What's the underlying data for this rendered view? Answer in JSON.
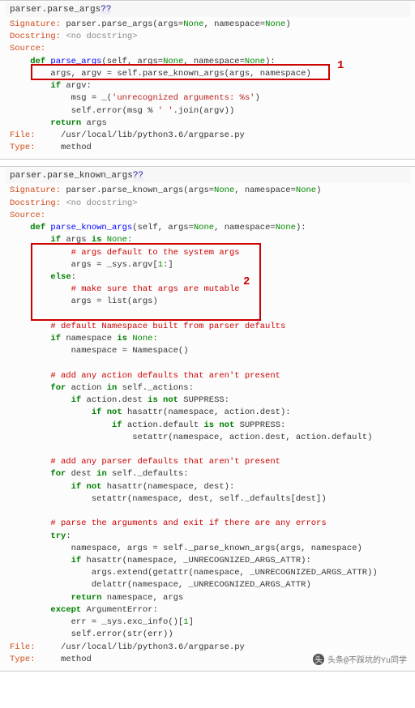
{
  "cell1": {
    "input_prefix": "parser.parse_args",
    "input_suffix": "??",
    "sig_lead": "Signature:",
    "sig_text": " parser.parse_args(args=",
    "sig_none1": "None",
    "sig_mid": ", namespace=",
    "sig_none2": "None",
    "sig_end": ")",
    "doc_lead": "Docstring:",
    "doc_text": " <no docstring>",
    "src_lead": "Source:",
    "def_kw": "def",
    "def_name": " parse_args",
    "def_params": "(self, args=",
    "def_none1": "None",
    "def_mid": ", namespace=",
    "def_none2": "None",
    "def_end": "):",
    "l_assign": "        args, argv = self.parse_known_args(args, namespace)",
    "l_if": "if",
    "l_if_rest": " argv:",
    "l_msg_a": "            msg = _(",
    "l_msg_str": "'unrecognized arguments: %s'",
    "l_msg_b": ")",
    "l_err_a": "            self.error(msg % ",
    "l_err_str": "' '",
    "l_err_b": ".join(argv))",
    "l_ret": "return",
    "l_ret_rest": " args",
    "file_lead": "File:",
    "file_path": "     /usr/local/lib/python3.6/argparse.py",
    "type_lead": "Type:",
    "type_val": "     method",
    "annotation": "1"
  },
  "cell2": {
    "input_prefix": "parser.parse_known_args",
    "input_suffix": "??",
    "sig_lead": "Signature:",
    "sig_text": " parser.parse_known_args(args=",
    "sig_none1": "None",
    "sig_mid": ", namespace=",
    "sig_none2": "None",
    "sig_end": ")",
    "doc_lead": "Docstring:",
    "doc_text": " <no docstring>",
    "src_lead": "Source:",
    "def_kw": "def",
    "def_name": " parse_known_args",
    "def_params": "(self, args=",
    "def_none1": "None",
    "def_mid": ", namespace=",
    "def_none2": "None",
    "def_end": "):",
    "b1": "if",
    "b1r": " args ",
    "b1is": "is",
    "b1n": " None:",
    "c1": "            # args default to the system args",
    "b2a": "            args = _sys.argv[",
    "b2n": "1",
    "b2b": ":]",
    "b3": "else",
    "b3r": ":",
    "c2": "            # make sure that args are mutable",
    "b4": "            args = list(args)",
    "c3": "        # default Namespace built from parser defaults",
    "b5": "if",
    "b5r": " namespace ",
    "b5is": "is",
    "b5n": " None:",
    "b6": "            namespace = Namespace()",
    "c4": "        # add any action defaults that aren't present",
    "b7": "for",
    "b7r": " action ",
    "b7in": "in",
    "b7e": " self._actions:",
    "b8": "if",
    "b8r": " action.dest ",
    "b8is": "is not",
    "b8e": " SUPPRESS:",
    "b9": "if not",
    "b9r": " hasattr(namespace, action.dest):",
    "b10": "if",
    "b10r": " action.default ",
    "b10is": "is not",
    "b10e": " SUPPRESS:",
    "b11": "                        setattr(namespace, action.dest, action.default)",
    "c5": "        # add any parser defaults that aren't present",
    "b12": "for",
    "b12r": " dest ",
    "b12in": "in",
    "b12e": " self._defaults:",
    "b13": "if not",
    "b13r": " hasattr(namespace, dest):",
    "b14": "                setattr(namespace, dest, self._defaults[dest])",
    "c6": "        # parse the arguments and exit if there are any errors",
    "b15": "try",
    "b15r": ":",
    "b16": "            namespace, args = self._parse_known_args(args, namespace)",
    "b17": "if",
    "b17r": " hasattr(namespace, _UNRECOGNIZED_ARGS_ATTR):",
    "b18": "                args.extend(getattr(namespace, _UNRECOGNIZED_ARGS_ATTR))",
    "b19": "                delattr(namespace, _UNRECOGNIZED_ARGS_ATTR)",
    "b20": "return",
    "b20r": " namespace, args",
    "b21": "except",
    "b21r": " ArgumentError:",
    "b22a": "            err = _sys.exc_info()[",
    "b22n": "1",
    "b22b": "]",
    "b23": "            self.error(str(err))",
    "file_lead": "File:",
    "file_path": "     /usr/local/lib/python3.6/argparse.py",
    "type_lead": "Type:",
    "type_val": "     method",
    "annotation": "2"
  },
  "watermark": "头条@不踩坑的Yu同学"
}
